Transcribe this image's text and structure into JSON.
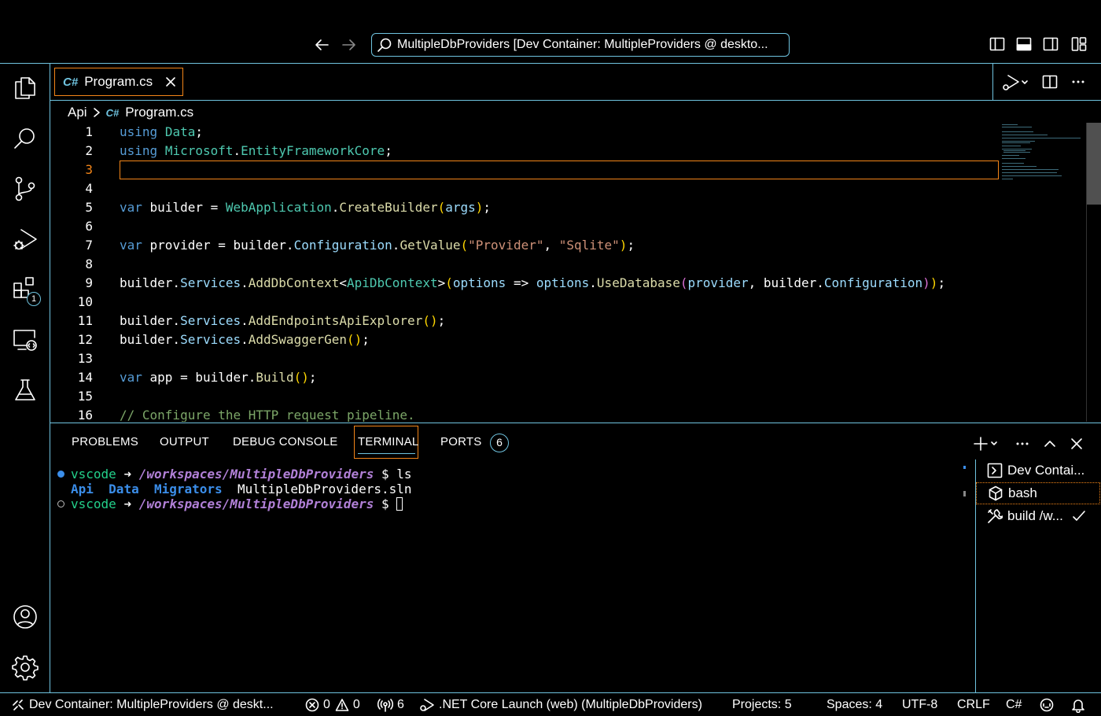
{
  "titlebar": {
    "search_text": "MultipleDbProviders [Dev Container: MultipleProviders @ deskto..."
  },
  "activity_bar": {
    "extensions_badge": "1"
  },
  "tabs": [
    {
      "label": "Program.cs",
      "icon": "csharp-icon",
      "active": true
    }
  ],
  "breadcrumb": {
    "folder": "Api",
    "file": "Program.cs"
  },
  "editor": {
    "active_line": 3,
    "lines": [
      {
        "n": "1",
        "tokens": [
          [
            "kw",
            "using"
          ],
          [
            "",
            " "
          ],
          [
            "ty",
            "Data"
          ],
          [
            "",
            ";"
          ]
        ]
      },
      {
        "n": "2",
        "tokens": [
          [
            "kw",
            "using"
          ],
          [
            "",
            " "
          ],
          [
            "ty",
            "Microsoft"
          ],
          [
            "",
            "."
          ],
          [
            "ty",
            "EntityFrameworkCore"
          ],
          [
            "",
            ";"
          ]
        ]
      },
      {
        "n": "3",
        "tokens": []
      },
      {
        "n": "4",
        "tokens": []
      },
      {
        "n": "5",
        "tokens": [
          [
            "kw",
            "var"
          ],
          [
            "",
            " builder = "
          ],
          [
            "ty",
            "WebApplication"
          ],
          [
            "",
            "."
          ],
          [
            "fn",
            "CreateBuilder"
          ],
          [
            "p1",
            "("
          ],
          [
            "pr",
            "args"
          ],
          [
            "p1",
            ")"
          ],
          [
            "",
            ";"
          ]
        ]
      },
      {
        "n": "6",
        "tokens": []
      },
      {
        "n": "7",
        "tokens": [
          [
            "kw",
            "var"
          ],
          [
            "",
            " provider = builder."
          ],
          [
            "pr",
            "Configuration"
          ],
          [
            "",
            "."
          ],
          [
            "fn",
            "GetValue"
          ],
          [
            "p1",
            "("
          ],
          [
            "str",
            "\"Provider\""
          ],
          [
            "",
            ", "
          ],
          [
            "str",
            "\"Sqlite\""
          ],
          [
            "p1",
            ")"
          ],
          [
            "",
            ";"
          ]
        ]
      },
      {
        "n": "8",
        "tokens": []
      },
      {
        "n": "9",
        "tokens": [
          [
            "",
            "builder."
          ],
          [
            "pr",
            "Services"
          ],
          [
            "",
            "."
          ],
          [
            "fn",
            "AddDbContext"
          ],
          [
            "",
            "<"
          ],
          [
            "ty",
            "ApiDbContext"
          ],
          [
            "",
            ">"
          ],
          [
            "p1",
            "("
          ],
          [
            "pr",
            "options"
          ],
          [
            "",
            ""
          ],
          [
            "",
            ""
          ],
          [
            "",
            ""
          ],
          [
            "",
            ""
          ],
          [
            "",
            ""
          ],
          [
            "",
            ""
          ],
          [
            "",
            ""
          ],
          [
            "",
            " => "
          ],
          [
            "pr",
            "options"
          ],
          [
            "",
            "."
          ],
          [
            "fn",
            "UseDatabase"
          ],
          [
            "p2",
            "("
          ],
          [
            "pr",
            "provider"
          ],
          [
            "",
            ", builder."
          ],
          [
            "pr",
            "Configuration"
          ],
          [
            "p2",
            ")"
          ],
          [
            "p1",
            ")"
          ],
          [
            "",
            ";"
          ]
        ]
      },
      {
        "n": "10",
        "tokens": []
      },
      {
        "n": "11",
        "tokens": [
          [
            "",
            "builder."
          ],
          [
            "pr",
            "Services"
          ],
          [
            "",
            "."
          ],
          [
            "fn",
            "AddEndpointsApiExplorer"
          ],
          [
            "p1",
            "()"
          ],
          [
            "",
            ";"
          ]
        ]
      },
      {
        "n": "12",
        "tokens": [
          [
            "",
            "builder."
          ],
          [
            "pr",
            "Services"
          ],
          [
            "",
            "."
          ],
          [
            "fn",
            "AddSwaggerGen"
          ],
          [
            "p1",
            "()"
          ],
          [
            "",
            ";"
          ]
        ]
      },
      {
        "n": "13",
        "tokens": []
      },
      {
        "n": "14",
        "tokens": [
          [
            "kw",
            "var"
          ],
          [
            "",
            " app = builder."
          ],
          [
            "fn",
            "Build"
          ],
          [
            "p1",
            "()"
          ],
          [
            "",
            ";"
          ]
        ]
      },
      {
        "n": "15",
        "tokens": []
      },
      {
        "n": "16",
        "tokens": [
          [
            "cm",
            "// Configure the HTTP request pipeline."
          ]
        ]
      }
    ]
  },
  "panel": {
    "tabs": [
      "PROBLEMS",
      "OUTPUT",
      "DEBUG CONSOLE",
      "TERMINAL",
      "PORTS"
    ],
    "active_tab": "TERMINAL",
    "ports_badge": "6",
    "terminal": {
      "line1": {
        "user": "vscode",
        "arrow": "➜",
        "path": "/workspaces/MultipleDbProviders",
        "prompt": "$",
        "command": "ls"
      },
      "line2": {
        "dirs": [
          "Api",
          "Data",
          "Migrators"
        ],
        "file": "MultipleDbProviders.sln"
      },
      "line3": {
        "user": "vscode",
        "arrow": "➜",
        "path": "/workspaces/MultipleDbProviders",
        "prompt": "$"
      }
    },
    "terminal_list": [
      {
        "label": "Dev Contai...",
        "icon": "terminal-icon"
      },
      {
        "label": "bash",
        "icon": "cube-icon"
      },
      {
        "label": "build /w...",
        "icon": "tools-icon",
        "status": "check-icon"
      }
    ]
  },
  "statusbar": {
    "remote": "Dev Container: MultipleProviders @ deskt...",
    "errors": "0",
    "warnings": "0",
    "ports": "6",
    "launch": ".NET Core Launch (web) (MultipleDbProviders)",
    "projects": "Projects: 5",
    "spaces": "Spaces: 4",
    "encoding": "UTF-8",
    "eol": "CRLF",
    "language": "C#"
  }
}
